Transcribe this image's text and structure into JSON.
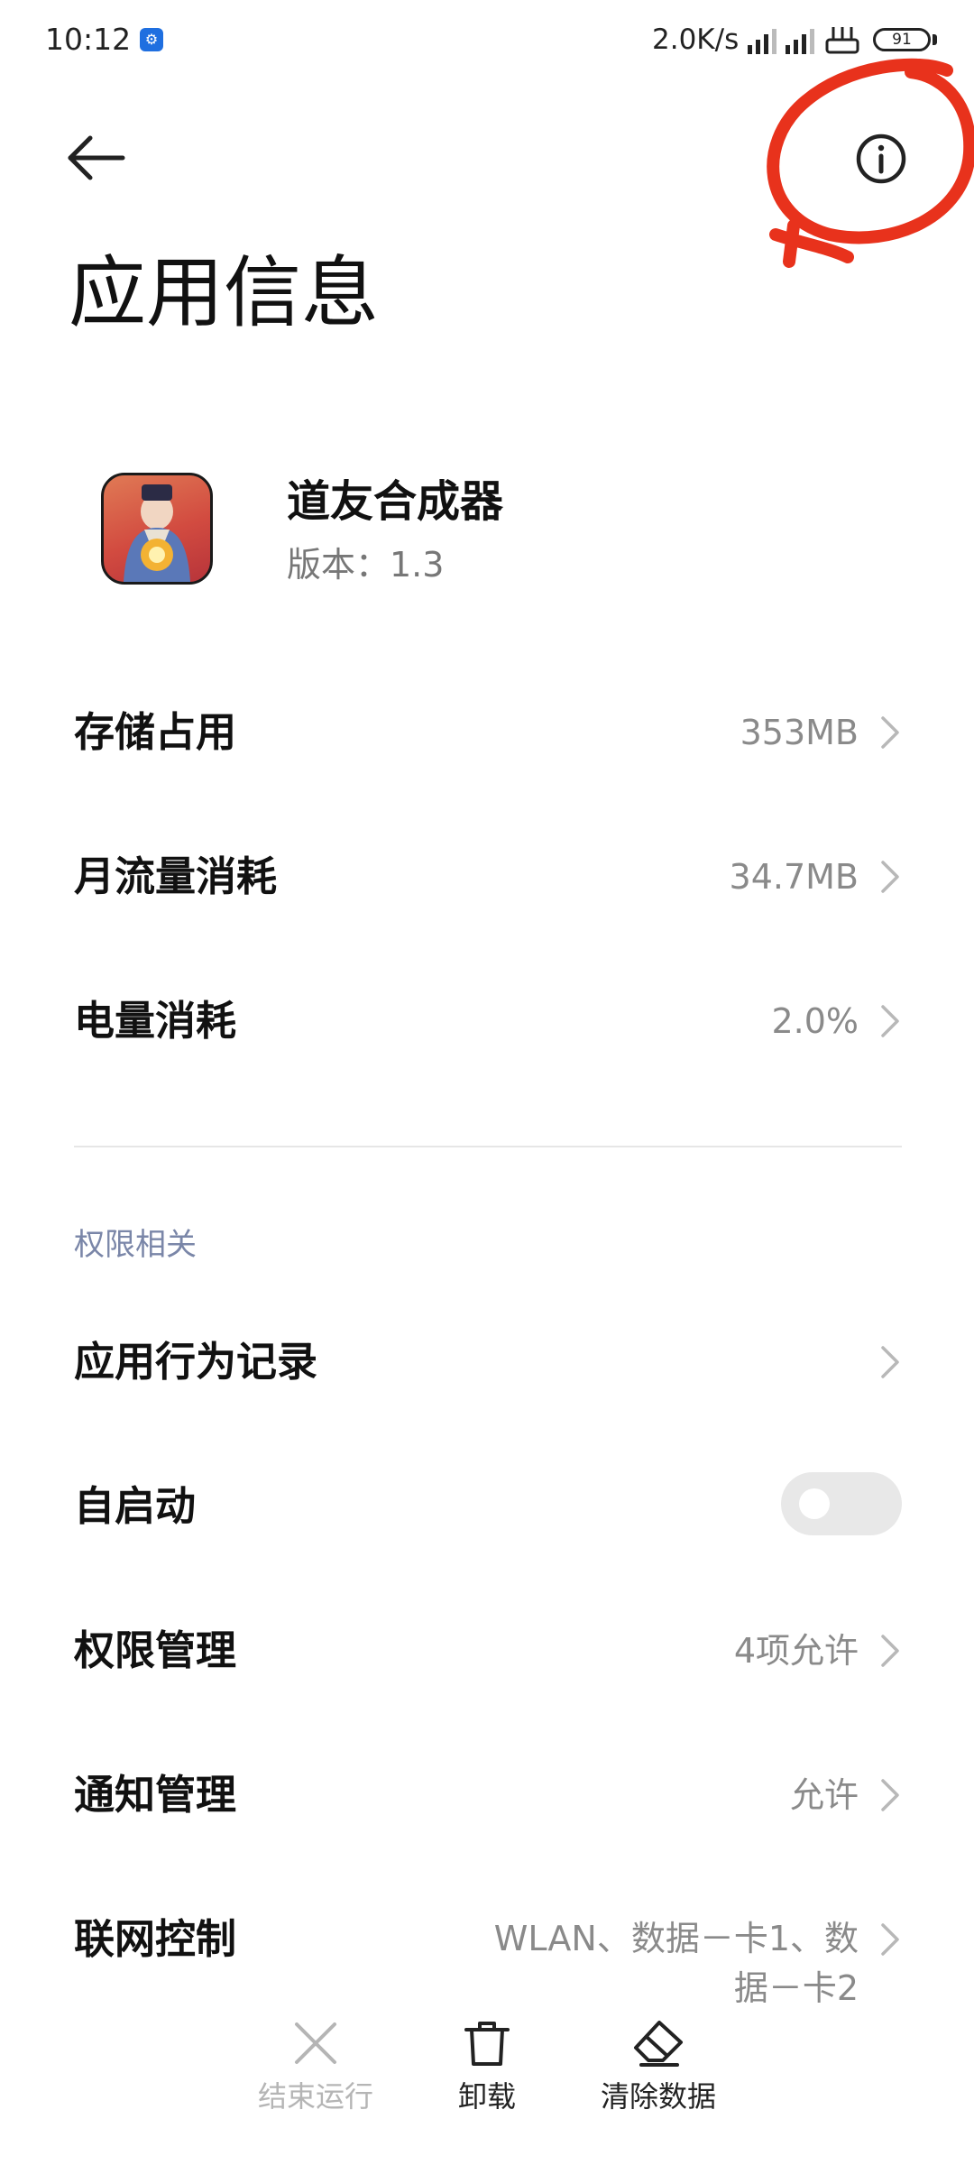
{
  "status_bar": {
    "time": "10:12",
    "net_speed": "2.0K/s",
    "battery": "91",
    "notification_icon": "app-notification-icon"
  },
  "header": {
    "back_icon": "arrow-left-icon",
    "info_icon": "info-circle-icon",
    "title": "应用信息"
  },
  "app": {
    "name": "道友合成器",
    "version": "版本：1.3",
    "icon": "app-icon"
  },
  "usage": [
    {
      "label": "存储占用",
      "value": "353MB"
    },
    {
      "label": "月流量消耗",
      "value": "34.7MB"
    },
    {
      "label": "电量消耗",
      "value": "2.0%"
    }
  ],
  "permissions": {
    "section_title": "权限相关",
    "rows": [
      {
        "label": "应用行为记录",
        "value": ""
      },
      {
        "label": "自启动",
        "toggle": false
      },
      {
        "label": "权限管理",
        "value": "4项允许"
      },
      {
        "label": "通知管理",
        "value": "允许"
      },
      {
        "label": "联网控制",
        "value": "WLAN、数据－卡1、数据－卡2"
      }
    ]
  },
  "bottom_actions": [
    {
      "label": "结束运行",
      "icon": "close-icon",
      "enabled": false
    },
    {
      "label": "卸载",
      "icon": "trash-icon",
      "enabled": true
    },
    {
      "label": "清除数据",
      "icon": "eraser-icon",
      "enabled": true
    }
  ],
  "colors": {
    "annotation": "#e8321c",
    "disabled_text": "#b5b5b5",
    "section_header": "#7a86a8"
  }
}
